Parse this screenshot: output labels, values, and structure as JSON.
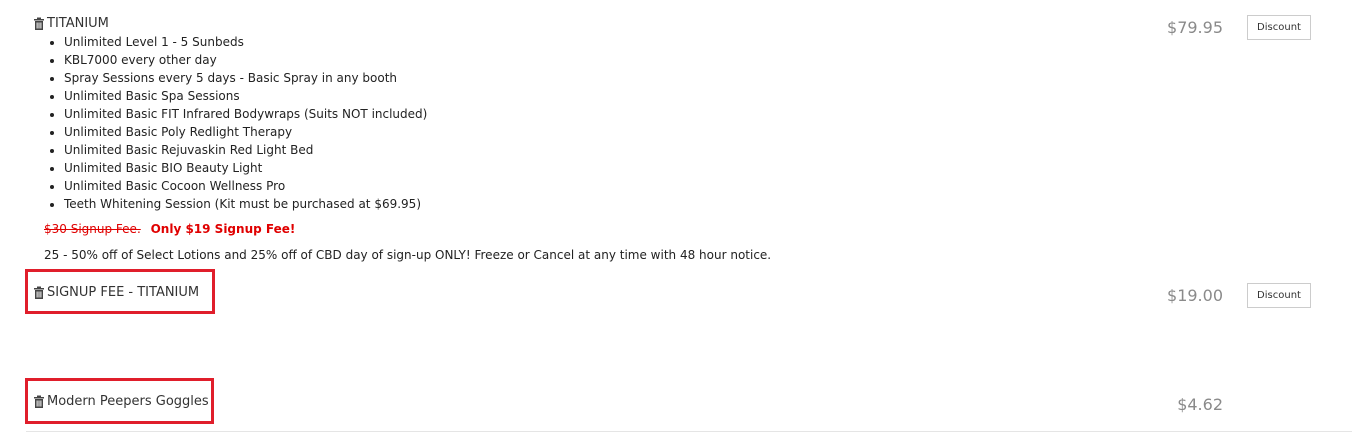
{
  "items": [
    {
      "title": "TITANIUM",
      "price": "$79.95",
      "discount_label": "Discount",
      "features": [
        "Unlimited Level 1 - 5 Sunbeds",
        "KBL7000 every other day",
        "Spray Sessions every 5 days - Basic Spray in any booth",
        "Unlimited Basic Spa Sessions",
        "Unlimited Basic FIT Infrared Bodywraps (Suits NOT included)",
        "Unlimited Basic Poly Redlight Therapy",
        "Unlimited Basic Rejuvaskin Red Light Bed",
        "Unlimited Basic BIO Beauty Light",
        "Unlimited Basic Cocoon Wellness Pro",
        "Teeth Whitening Session (Kit must be purchased at $69.95)"
      ],
      "old_fee": "$30 Signup Fee.",
      "new_fee": "Only $19 Signup Fee!",
      "note": "25 - 50% off of Select Lotions and 25% off of CBD day of sign-up ONLY! Freeze or Cancel at any time with 48 hour notice."
    },
    {
      "title": "SIGNUP FEE - TITANIUM",
      "price": "$19.00",
      "discount_label": "Discount"
    },
    {
      "title": "Modern Peepers Goggles",
      "price": "$4.62"
    }
  ],
  "colors": {
    "highlight": "#e01e2b",
    "promo_red": "#e00000",
    "price_gray": "#8a8a8a"
  },
  "icons": {
    "remove": "trash-icon"
  }
}
